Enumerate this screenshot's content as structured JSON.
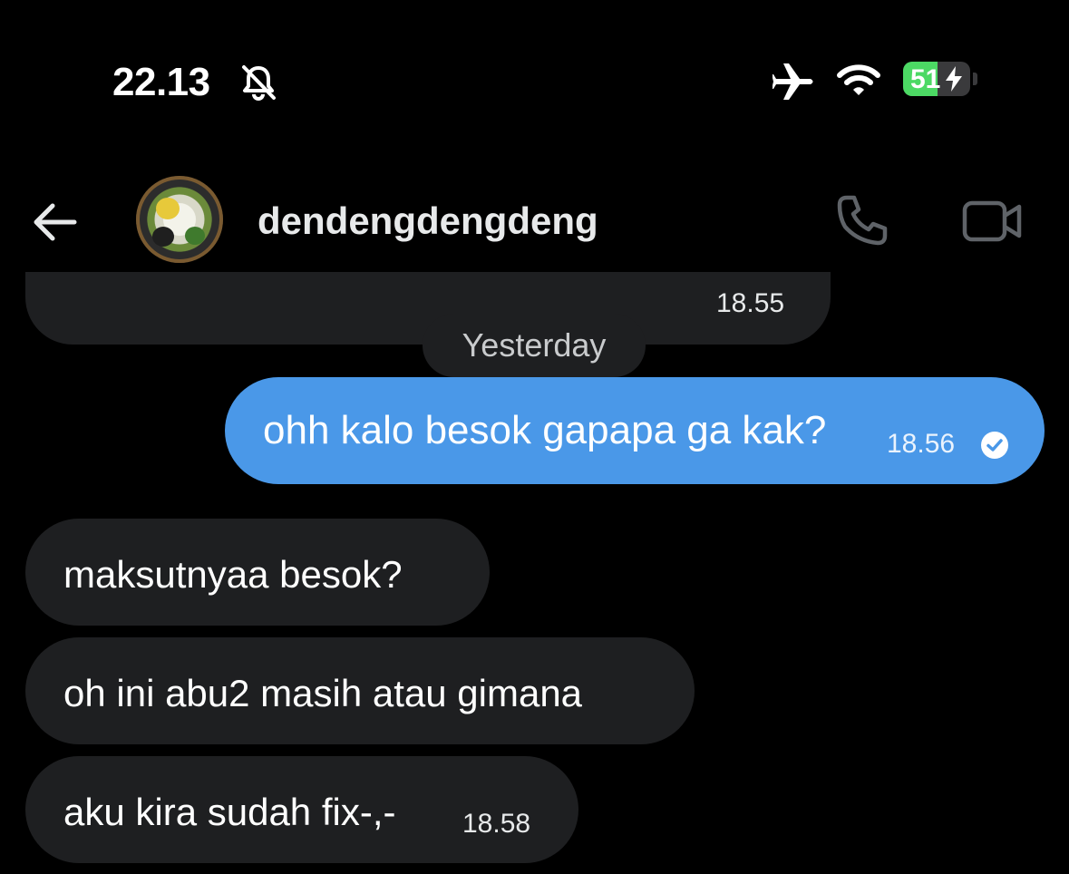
{
  "status_bar": {
    "time": "22.13",
    "battery_level": "51",
    "battery_fraction": 0.51,
    "icons": [
      "bell-muted-icon",
      "airplane-icon",
      "wifi-icon",
      "battery-charging-icon"
    ]
  },
  "header": {
    "username": "dendengdengdeng",
    "back_icon": "back-arrow-icon",
    "call_icon": "phone-icon",
    "video_icon": "video-camera-icon"
  },
  "chat": {
    "previous_message_time": "18.55",
    "day_separator": "Yesterday",
    "messages": [
      {
        "direction": "outgoing",
        "text": "ohh kalo besok gapapa ga kak?",
        "time": "18.56",
        "status_icon": "read-check-icon"
      },
      {
        "direction": "incoming",
        "text": "maksutnyaa besok?",
        "time": ""
      },
      {
        "direction": "incoming",
        "text": "oh ini abu2 masih atau gimana",
        "time": ""
      },
      {
        "direction": "incoming",
        "text": "aku kira sudah fix-,-",
        "time": "18.58"
      }
    ]
  },
  "colors": {
    "background": "#000000",
    "incoming_bubble": "#1e1f21",
    "outgoing_bubble": "#4a98e8",
    "battery_fill": "#4cd964",
    "icon_dim": "#5f6368"
  }
}
